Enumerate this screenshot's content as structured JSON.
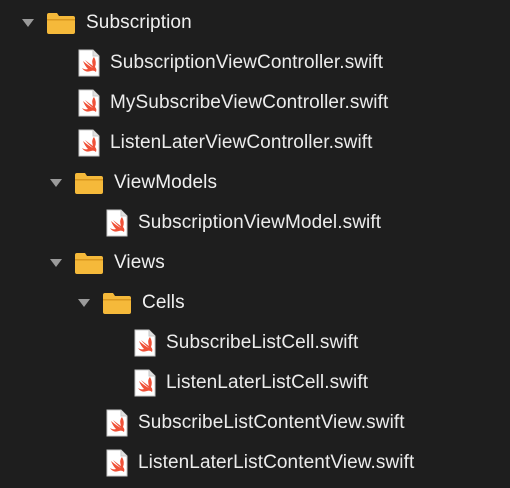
{
  "navigator": {
    "items": [
      {
        "kind": "folder",
        "name": "Subscription",
        "icon": "folder-icon",
        "expanded": true
      },
      {
        "kind": "file",
        "name": "SubscriptionViewController.swift",
        "icon": "swift-file-icon"
      },
      {
        "kind": "file",
        "name": "MySubscribeViewController.swift",
        "icon": "swift-file-icon"
      },
      {
        "kind": "file",
        "name": "ListenLaterViewController.swift",
        "icon": "swift-file-icon"
      },
      {
        "kind": "folder",
        "name": "ViewModels",
        "icon": "folder-icon",
        "expanded": true
      },
      {
        "kind": "file",
        "name": "SubscriptionViewModel.swift",
        "icon": "swift-file-icon"
      },
      {
        "kind": "folder",
        "name": "Views",
        "icon": "folder-icon",
        "expanded": true
      },
      {
        "kind": "folder",
        "name": "Cells",
        "icon": "folder-icon",
        "expanded": true
      },
      {
        "kind": "file",
        "name": "SubscribeListCell.swift",
        "icon": "swift-file-icon"
      },
      {
        "kind": "file",
        "name": "ListenLaterListCell.swift",
        "icon": "swift-file-icon"
      },
      {
        "kind": "file",
        "name": "SubscribeListContentView.swift",
        "icon": "swift-file-icon"
      },
      {
        "kind": "file",
        "name": "ListenLaterListContentView.swift",
        "icon": "swift-file-icon"
      }
    ]
  },
  "colors": {
    "background": "#1e1e1e",
    "folder": "#f5b93a",
    "swift": "#f05138",
    "text": "#ececec",
    "disclosure": "#9a9a9a"
  }
}
